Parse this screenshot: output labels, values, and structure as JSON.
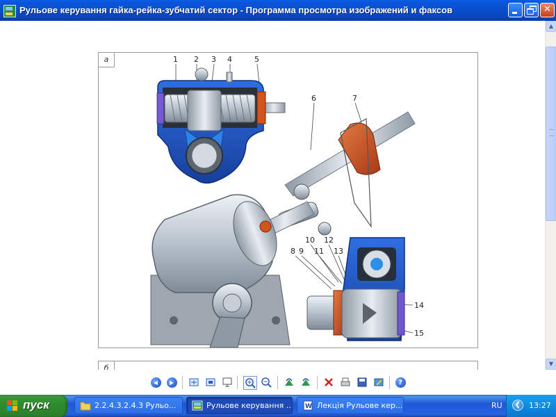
{
  "window": {
    "title": "Рульове керування  гайка-рейка-зубчатий сектор - Программа просмотра изображений и факсов",
    "icons": {
      "app": "image-viewer-icon",
      "minimize": "minimize-icon",
      "maximize": "restore-icon",
      "close": "close-icon"
    }
  },
  "document": {
    "panel_a_tag": "а",
    "panel_b_tag": "б",
    "callouts": [
      "1",
      "2",
      "3",
      "4",
      "5",
      "6",
      "7",
      "8",
      "9",
      "10",
      "11",
      "12",
      "13",
      "14",
      "15"
    ]
  },
  "toolbar": {
    "icons": [
      "previous-image-icon",
      "next-image-icon",
      "best-fit-icon",
      "actual-size-icon",
      "slideshow-icon",
      "zoom-in-icon",
      "zoom-out-icon",
      "rotate-clockwise-icon",
      "rotate-counterclockwise-icon",
      "delete-icon",
      "print-icon",
      "save-icon",
      "edit-icon",
      "help-icon"
    ]
  },
  "taskbar": {
    "start_label": "пуск",
    "tasks": [
      {
        "label": "2.2.4.3.2.4.3 Рульо...",
        "icon": "folder-icon",
        "active": false
      },
      {
        "label": "Рульове керування ...",
        "icon": "image-viewer-icon",
        "active": true
      },
      {
        "label": "Лекція Рульове кер...",
        "icon": "word-document-icon",
        "active": false
      }
    ],
    "language": "RU",
    "clock": "13:27"
  },
  "colors": {
    "titlebar": "#0a52d6",
    "taskbar": "#245edb",
    "start_button": "#34923a",
    "tray": "#0f8ae0",
    "steering_blue": "#1f5bd0",
    "steering_orange": "#d1541f",
    "housing_gray": "#b9c3cc"
  }
}
